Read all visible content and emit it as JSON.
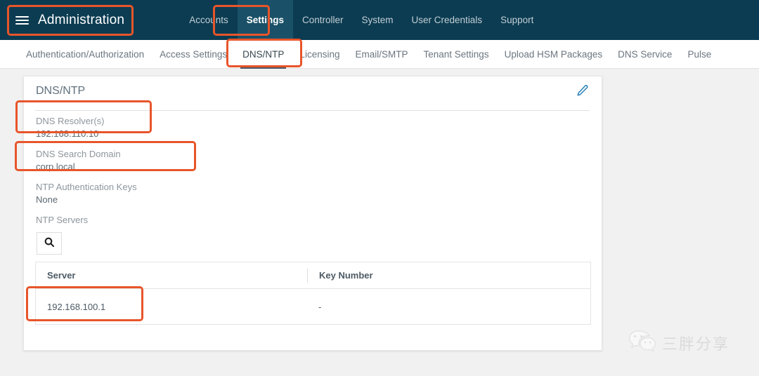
{
  "header": {
    "menu_icon": "hamburger-icon",
    "title": "Administration",
    "nav": [
      {
        "label": "Accounts",
        "active": false
      },
      {
        "label": "Settings",
        "active": true
      },
      {
        "label": "Controller",
        "active": false
      },
      {
        "label": "System",
        "active": false
      },
      {
        "label": "User Credentials",
        "active": false
      },
      {
        "label": "Support",
        "active": false
      }
    ]
  },
  "subtabs": [
    {
      "label": "Authentication/Authorization",
      "active": false
    },
    {
      "label": "Access Settings",
      "active": false
    },
    {
      "label": "DNS/NTP",
      "active": true
    },
    {
      "label": "Licensing",
      "active": false
    },
    {
      "label": "Email/SMTP",
      "active": false
    },
    {
      "label": "Tenant Settings",
      "active": false
    },
    {
      "label": "Upload HSM Packages",
      "active": false
    },
    {
      "label": "DNS Service",
      "active": false
    },
    {
      "label": "Pulse",
      "active": false
    }
  ],
  "card": {
    "title": "DNS/NTP",
    "edit_icon": "pencil-edit-icon",
    "fields": [
      {
        "label": "DNS Resolver(s)",
        "value": "192.168.110.10"
      },
      {
        "label": "DNS Search Domain",
        "value": "corp.local"
      },
      {
        "label": "NTP Authentication Keys",
        "value": "None"
      },
      {
        "label": "NTP Servers",
        "value": ""
      }
    ],
    "search_icon": "search-icon",
    "table": {
      "columns": [
        "Server",
        "Key Number"
      ],
      "rows": [
        {
          "server": "192.168.100.1",
          "key_number": "-"
        }
      ]
    }
  },
  "annotations": {
    "color": "#e8552a",
    "boxes": [
      "administration-title",
      "settings-nav-tab",
      "dns-ntp-subtab",
      "dns-resolvers-field",
      "dns-search-domain-field",
      "ntp-server-row"
    ]
  },
  "watermark": {
    "icon": "wechat-icon",
    "text": "三胖分享"
  }
}
